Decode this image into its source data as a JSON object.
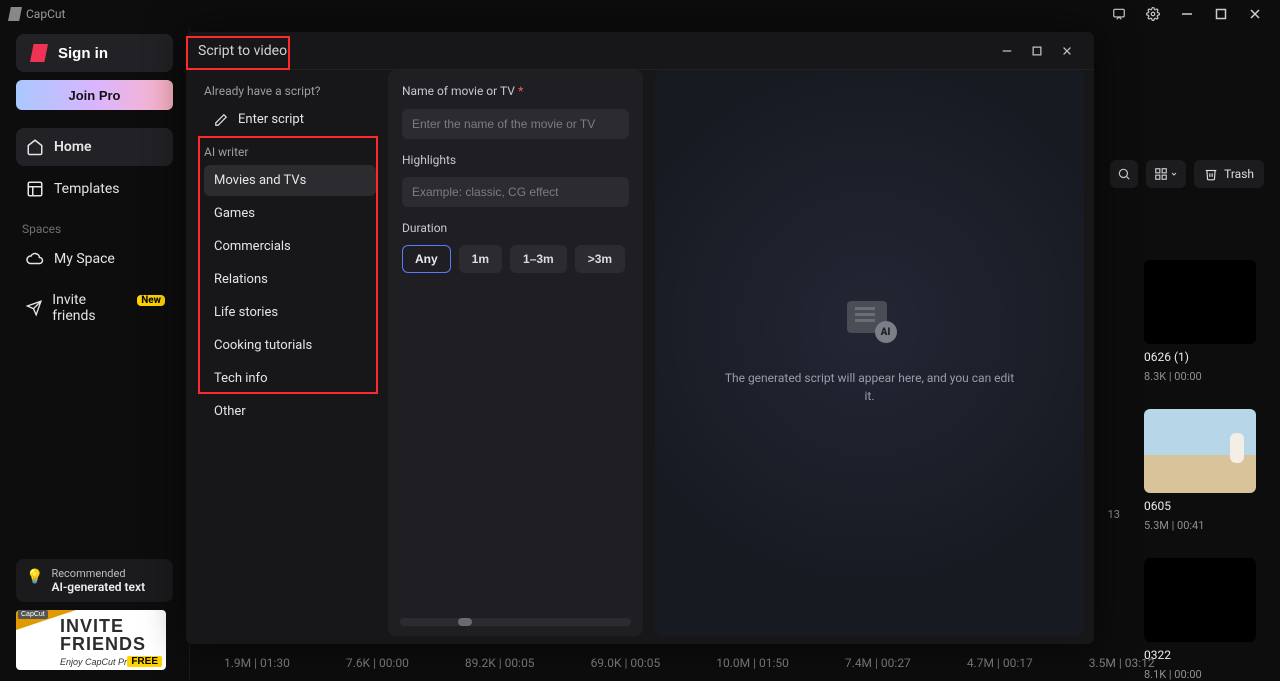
{
  "app": {
    "brand": "CapCut"
  },
  "titlebar_icons": [
    "chat-icon",
    "settings-icon",
    "minimize-icon",
    "maximize-icon",
    "close-icon"
  ],
  "sidebar": {
    "sign_in": "Sign in",
    "join_pro": "Join Pro",
    "items": [
      {
        "label": "Home"
      },
      {
        "label": "Templates"
      }
    ],
    "spaces_label": "Spaces",
    "spaces": [
      {
        "label": "My Space"
      }
    ],
    "invite": {
      "label": "Invite friends",
      "badge": "New"
    },
    "rec": {
      "line1": "Recommended",
      "line2": "AI-generated text"
    },
    "banner": {
      "line1": "INVITE",
      "line2": "FRIENDS",
      "line3": "Enjoy CapCut Pro for",
      "tag": "FREE",
      "brandtag": "CapCut"
    }
  },
  "toolbar": {
    "trash": "Trash"
  },
  "modal": {
    "title": "Script to video",
    "already_have": "Already have a script?",
    "enter_script": "Enter script",
    "ai_writer": "AI writer",
    "categories": [
      "Movies and TVs",
      "Games",
      "Commercials",
      "Relations",
      "Life stories",
      "Cooking tutorials",
      "Tech info",
      "Other"
    ],
    "form": {
      "movie_label": "Name of movie or TV",
      "movie_placeholder": "Enter the name of the movie or TV",
      "highlights_label": "Highlights",
      "highlights_placeholder": "Example: classic, CG effect",
      "duration_label": "Duration",
      "durations": [
        "Any",
        "1m",
        "1–3m",
        ">3m"
      ]
    },
    "preview_text": "The generated script will appear here, and you can edit it.",
    "ai_badge": "AI"
  },
  "thumbs": [
    {
      "title": "0626 (1)",
      "meta": "8.3K | 00:00"
    },
    {
      "title": "0605",
      "meta": "5.3M | 00:41"
    },
    {
      "title": "0322",
      "meta": "8.1K | 00:00"
    }
  ],
  "bottom_stats": [
    "1.9M | 01:30",
    "7.6K | 00:00",
    "89.2K | 00:05",
    "69.0K | 00:05",
    "10.0M | 01:50",
    "7.4M | 00:27",
    "4.7M | 00:17",
    "3.5M | 03:12"
  ],
  "partial_meta": "13"
}
